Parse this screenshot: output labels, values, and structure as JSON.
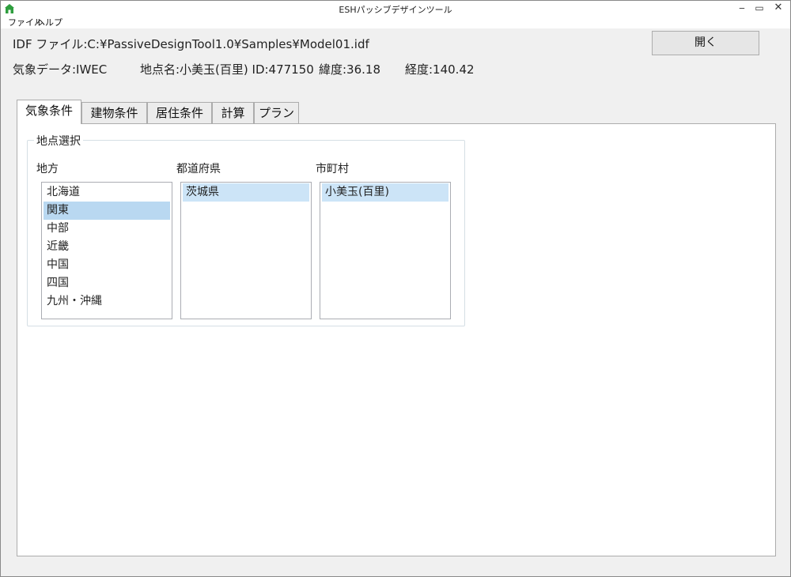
{
  "window": {
    "title": "ESHパッシブデザインツール",
    "minimize_glyph": "‒",
    "maximize_glyph": "▭",
    "close_glyph": "✕"
  },
  "menu": [
    "ファイル",
    "ヘルプ"
  ],
  "info": {
    "idf_line": "IDF ファイル:C:¥PassiveDesignTool1.0¥Samples¥Model01.idf",
    "weather_data": "気象データ:IWEC",
    "location": "地点名:小美玉(百里) ID:477150",
    "latitude": "緯度:36.18",
    "longitude": "経度:140.42"
  },
  "open_button": "開く",
  "tabs": [
    {
      "label": "気象条件",
      "active": true
    },
    {
      "label": "建物条件",
      "active": false
    },
    {
      "label": "居住条件",
      "active": false
    },
    {
      "label": "計算",
      "active": false
    },
    {
      "label": "プラン",
      "active": false
    }
  ],
  "location_select": {
    "legend": "地点選択",
    "region": {
      "label": "地方",
      "items": [
        "北海道",
        "関東",
        "中部",
        "近畿",
        "中国",
        "四国",
        "九州・沖縄"
      ],
      "selected": "関東"
    },
    "prefecture": {
      "label": "都道府県",
      "items": [
        "茨城県"
      ],
      "selected": "茨城県"
    },
    "city": {
      "label": "市町村",
      "items": [
        "小美玉(百里)"
      ],
      "selected": "小美玉(百里)"
    }
  },
  "colors": {
    "selection": "#cce4f7",
    "selection_strong": "#b9d8f1",
    "icon_green": "#2e9e3e"
  },
  "icons": [
    "app-house-icon"
  ]
}
